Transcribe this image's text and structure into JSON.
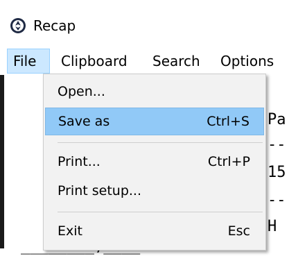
{
  "window": {
    "title": "Recap",
    "icon": "app-logo-icon",
    "icon_color": "#1f2a44"
  },
  "menubar": {
    "items": [
      {
        "label": "File",
        "active": true
      },
      {
        "label": "Clipboard"
      },
      {
        "label": "Search"
      },
      {
        "label": "Options"
      }
    ]
  },
  "background_text": {
    "line1": "Pa",
    "line2": "--",
    "line3": "15",
    "line4": "--",
    "line5": "H",
    "line6": "________,____"
  },
  "file_menu": {
    "items": [
      {
        "label": "Open...",
        "shortcut": ""
      },
      {
        "label": "Save as",
        "shortcut": "Ctrl+S",
        "highlighted": true
      },
      {
        "label": "Print...",
        "shortcut": "Ctrl+P"
      },
      {
        "label": "Print setup...",
        "shortcut": ""
      },
      {
        "label": "Exit",
        "shortcut": "Esc"
      }
    ]
  },
  "colors": {
    "menu_active": "#cce8ff",
    "item_highlight": "#91c9f7",
    "dropdown_bg": "#f2f2f2"
  }
}
